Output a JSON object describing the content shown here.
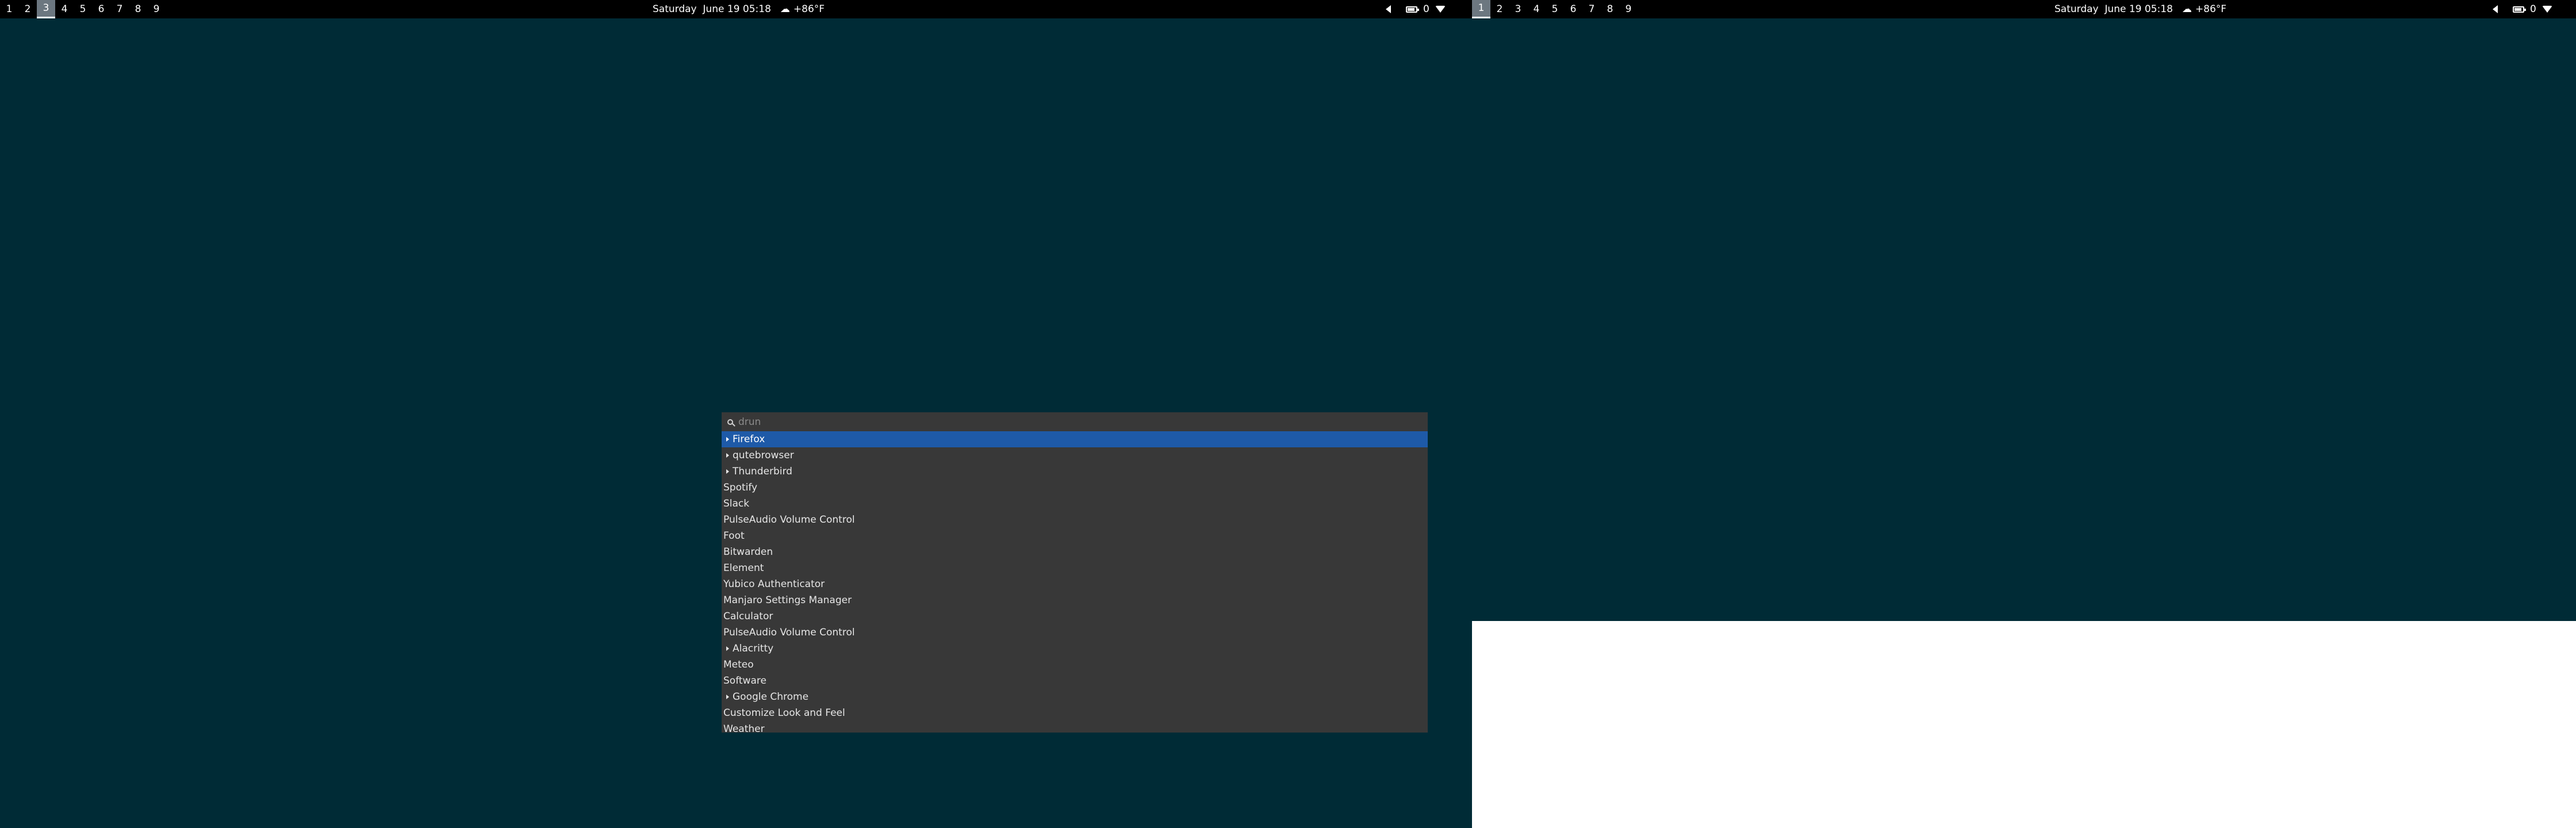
{
  "left_monitor": {
    "workspaces": [
      "1",
      "2",
      "3",
      "4",
      "5",
      "6",
      "7",
      "8",
      "9"
    ],
    "active_workspace": "3",
    "clock": {
      "day": "Saturday",
      "date": "June 19",
      "time": "05:18",
      "weather": "+86°F"
    },
    "tray": {
      "notifications": "0"
    }
  },
  "right_monitor": {
    "workspaces": [
      "1",
      "2",
      "3",
      "4",
      "5",
      "6",
      "7",
      "8",
      "9"
    ],
    "active_workspace": "1",
    "clock": {
      "day": "Saturday",
      "date": "June 19",
      "time": "05:18",
      "weather": "+86°F"
    },
    "tray": {
      "notifications": "0"
    }
  },
  "launcher": {
    "placeholder": "drun",
    "query": "",
    "results": [
      {
        "label": "Firefox",
        "expandable": true,
        "selected": true
      },
      {
        "label": "qutebrowser",
        "expandable": true,
        "selected": false
      },
      {
        "label": "Thunderbird",
        "expandable": true,
        "selected": false
      },
      {
        "label": "Spotify",
        "expandable": false,
        "selected": false
      },
      {
        "label": "Slack",
        "expandable": false,
        "selected": false
      },
      {
        "label": "PulseAudio Volume Control",
        "expandable": false,
        "selected": false
      },
      {
        "label": "Foot",
        "expandable": false,
        "selected": false
      },
      {
        "label": "Bitwarden",
        "expandable": false,
        "selected": false
      },
      {
        "label": "Element",
        "expandable": false,
        "selected": false
      },
      {
        "label": "Yubico Authenticator",
        "expandable": false,
        "selected": false
      },
      {
        "label": "Manjaro Settings Manager",
        "expandable": false,
        "selected": false
      },
      {
        "label": "Calculator",
        "expandable": false,
        "selected": false
      },
      {
        "label": "PulseAudio Volume Control",
        "expandable": false,
        "selected": false
      },
      {
        "label": "Alacritty",
        "expandable": true,
        "selected": false
      },
      {
        "label": "Meteo",
        "expandable": false,
        "selected": false
      },
      {
        "label": "Software",
        "expandable": false,
        "selected": false
      },
      {
        "label": "Google Chrome",
        "expandable": true,
        "selected": false
      },
      {
        "label": "Customize Look and Feel",
        "expandable": false,
        "selected": false
      },
      {
        "label": "Weather",
        "expandable": false,
        "selected": false
      }
    ]
  },
  "colors": {
    "desktop": "#002b36",
    "bar": "#000000",
    "launcher_bg": "#383838",
    "selection": "#1e5aa8"
  }
}
